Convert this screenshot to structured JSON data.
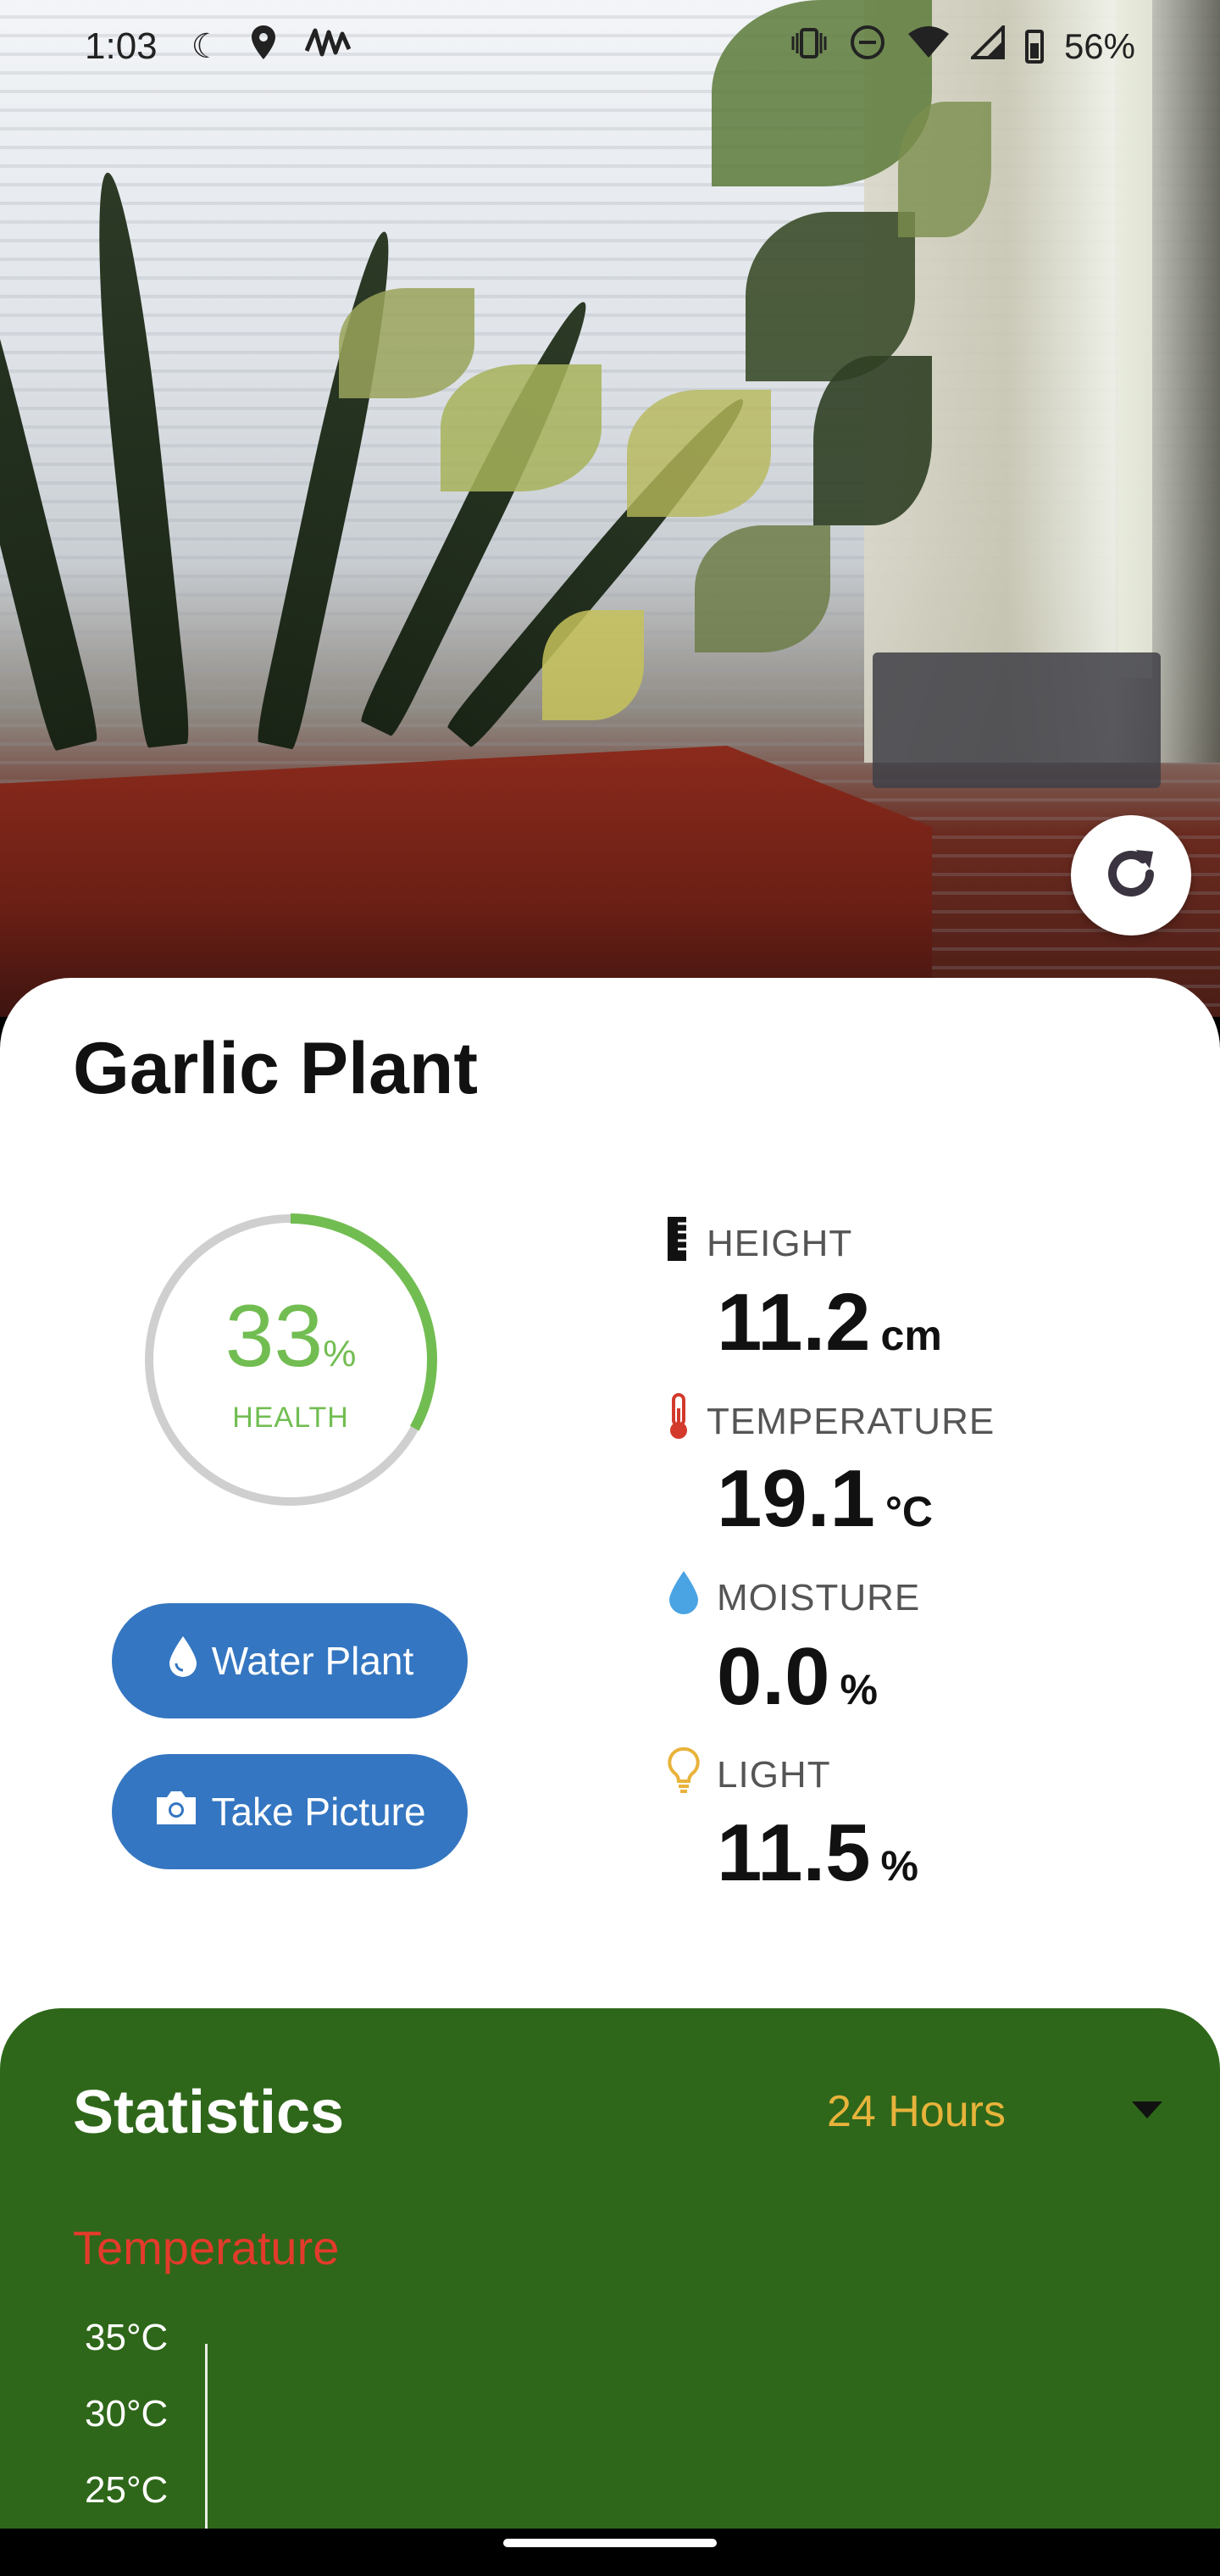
{
  "status_bar": {
    "time": "1:03",
    "battery": "56%"
  },
  "plant": {
    "name": "Garlic Plant",
    "health_value": "33",
    "health_unit": "%",
    "health_fraction": 0.33,
    "health_label": "HEALTH"
  },
  "actions": {
    "water_label": "Water Plant",
    "picture_label": "Take Picture"
  },
  "metrics": {
    "height": {
      "label": "HEIGHT",
      "value": "11.2",
      "unit": "cm"
    },
    "temperature": {
      "label": "TEMPERATURE",
      "value": "19.1",
      "unit": "°C"
    },
    "moisture": {
      "label": "MOISTURE",
      "value": "0.0",
      "unit": "%"
    },
    "light": {
      "label": "LIGHT",
      "value": "11.5",
      "unit": "%"
    }
  },
  "statistics": {
    "title": "Statistics",
    "range": "24 Hours",
    "chart_title": "Temperature",
    "y_ticks": [
      "35°C",
      "30°C",
      "25°C"
    ]
  },
  "colors": {
    "health": "#72bd52",
    "button": "#3476c1",
    "stats_bg": "#2e6719",
    "range": "#e8b33b",
    "temperature": "#e23b2b"
  }
}
